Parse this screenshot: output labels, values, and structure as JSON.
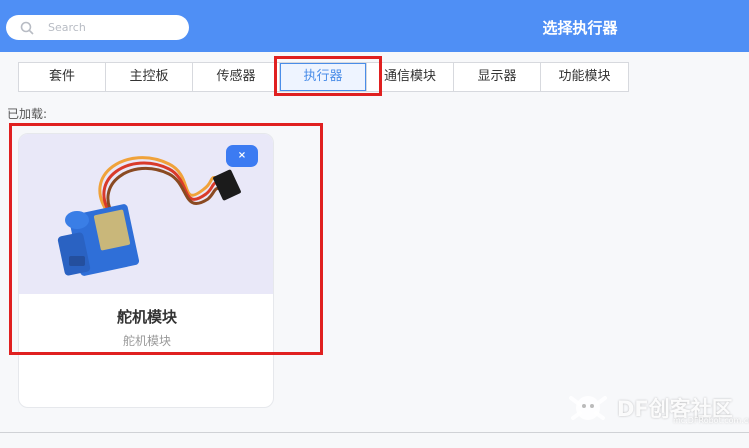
{
  "search": {
    "placeholder": "Search"
  },
  "header": {
    "title": "选择执行器"
  },
  "tabs": [
    {
      "label": "套件"
    },
    {
      "label": "主控板"
    },
    {
      "label": "传感器"
    },
    {
      "label": "执行器",
      "active": true
    },
    {
      "label": "通信模块"
    },
    {
      "label": "显示器"
    },
    {
      "label": "功能模块"
    }
  ],
  "loaded_label": "已加载:",
  "card": {
    "title": "舵机模块",
    "subtitle": "舵机模块",
    "remove_label": "×"
  },
  "watermark": {
    "text": "DF创客社区",
    "url": "mc.DFRobot.com.cn"
  },
  "colors": {
    "header": "#4f8ff5",
    "accent": "#4a8de8",
    "highlight": "#e02020"
  }
}
